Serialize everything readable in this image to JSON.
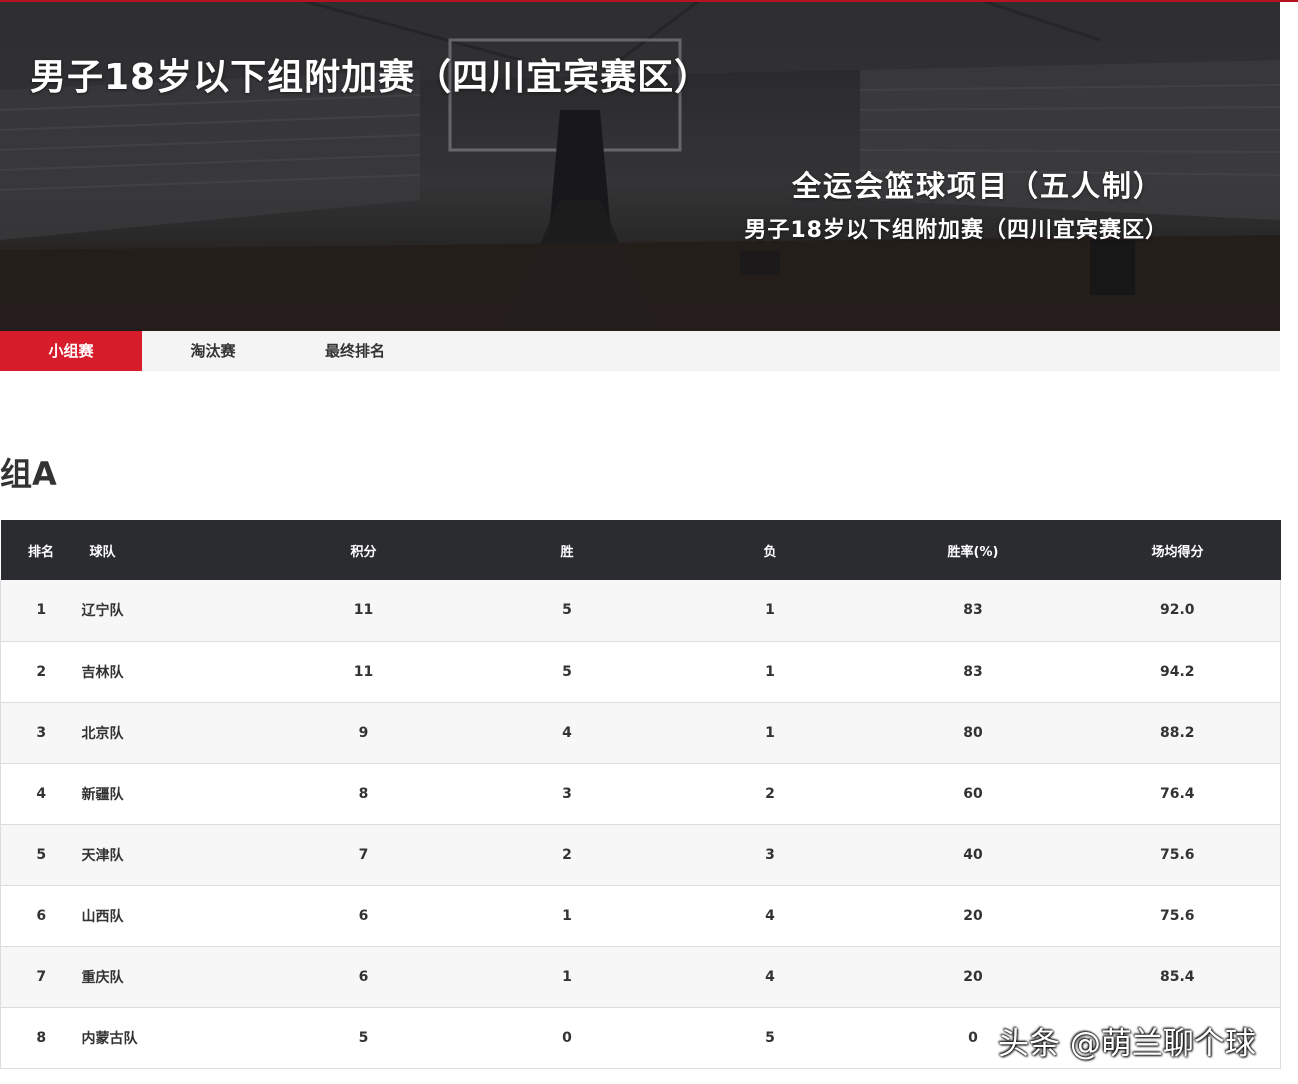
{
  "hero": {
    "title": "男子18岁以下组附加赛（四川宜宾赛区）",
    "event": "全运会篮球项目（五人制）",
    "subtitle": "男子18岁以下组附加赛（四川宜宾赛区）"
  },
  "tabs": [
    {
      "label": "小组赛",
      "active": true
    },
    {
      "label": "淘汰赛",
      "active": false
    },
    {
      "label": "最终排名",
      "active": false
    }
  ],
  "group": {
    "title": "组A",
    "columns": [
      "排名",
      "球队",
      "积分",
      "胜",
      "负",
      "胜率(%)",
      "场均得分"
    ],
    "rows": [
      [
        "1",
        "辽宁队",
        "11",
        "5",
        "1",
        "83",
        "92.0"
      ],
      [
        "2",
        "吉林队",
        "11",
        "5",
        "1",
        "83",
        "94.2"
      ],
      [
        "3",
        "北京队",
        "9",
        "4",
        "1",
        "80",
        "88.2"
      ],
      [
        "4",
        "新疆队",
        "8",
        "3",
        "2",
        "60",
        "76.4"
      ],
      [
        "5",
        "天津队",
        "7",
        "2",
        "3",
        "40",
        "75.6"
      ],
      [
        "6",
        "山西队",
        "6",
        "1",
        "4",
        "20",
        "75.6"
      ],
      [
        "7",
        "重庆队",
        "6",
        "1",
        "4",
        "20",
        "85.4"
      ],
      [
        "8",
        "内蒙古队",
        "5",
        "0",
        "5",
        "0",
        ""
      ]
    ]
  },
  "watermark": "头条 @萌兰聊个球",
  "colors": {
    "accent": "#d71d2b",
    "header_bg": "#2a2c30"
  }
}
